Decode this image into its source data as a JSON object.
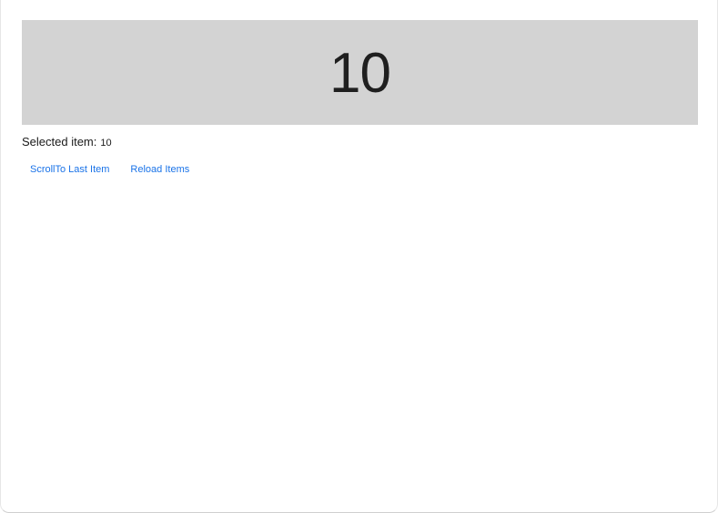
{
  "carousel": {
    "current_item": "10"
  },
  "selection": {
    "label": "Selected item:",
    "value": "10"
  },
  "actions": {
    "scroll_to_last": "ScrollTo Last Item",
    "reload_items": "Reload Items"
  },
  "colors": {
    "carousel_background": "#d3d3d3",
    "link": "#1a73e8"
  }
}
